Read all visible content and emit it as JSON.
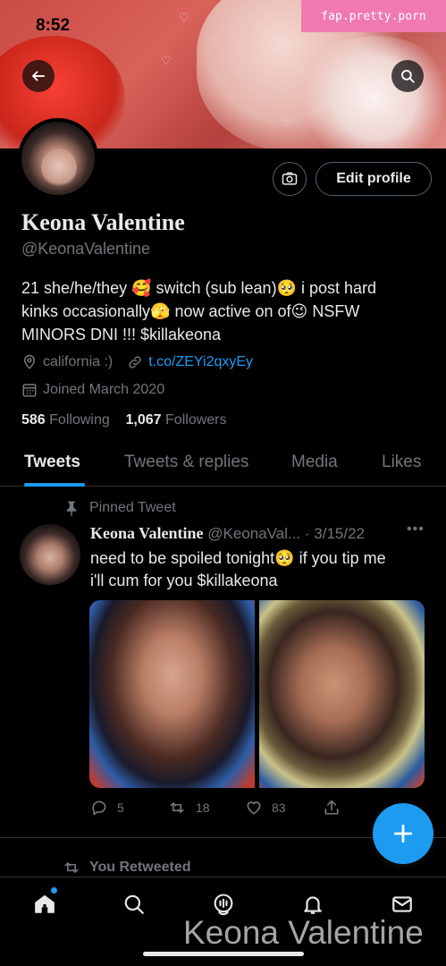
{
  "status_bar": {
    "time": "8:52"
  },
  "watermark_top": "fap.pretty.porn",
  "profile": {
    "name": "Keona Valentine",
    "handle": "@KeonaValentine",
    "bio_lines": [
      "21 she/he/they 🥰 switch (sub lean)🥺 i post hard",
      "kinks occasionally🫣 now active on of😉 NSFW",
      "MINORS DNI !!! $killakeona"
    ],
    "location": "california :)",
    "link": "t.co/ZEYi2qxyEy",
    "joined": "Joined March 2020",
    "following_count": "586",
    "following_label": "Following",
    "followers_count": "1,067",
    "followers_label": "Followers",
    "edit_profile_label": "Edit profile"
  },
  "tabs": [
    "Tweets",
    "Tweets & replies",
    "Media",
    "Likes"
  ],
  "pinned_tweet": {
    "pinned_label": "Pinned Tweet",
    "author_name": "Keona Valentine",
    "author_handle": "@KeonaVal...",
    "date": "· 3/15/22",
    "more": "•••",
    "text_lines": [
      "need to be spoiled tonight🥺  if you tip me",
      "i'll cum for you   $killakeona"
    ],
    "replies": "5",
    "retweets": "18",
    "likes": "83"
  },
  "retweet_label": "You Retweeted",
  "watermark_bottom": "Keona Valentine",
  "colors": {
    "accent": "#1d9bf0",
    "background": "#000000",
    "secondary_text": "#71767b"
  },
  "icons": {
    "nav": [
      "home-icon",
      "search-icon",
      "spaces-icon",
      "notifications-icon",
      "messages-icon"
    ]
  }
}
